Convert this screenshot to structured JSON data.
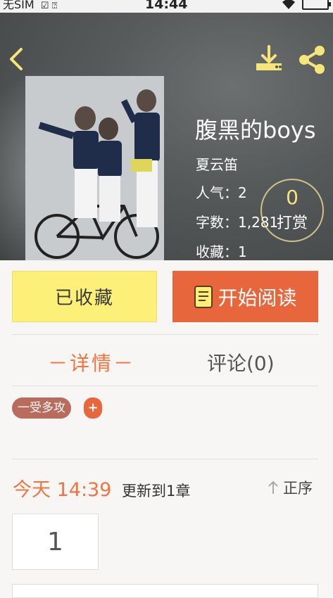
{
  "status_bar": {
    "carrier": "无SIM",
    "time": "14:44"
  },
  "book": {
    "title": "腹黑的boys",
    "author": "夏云笛",
    "popularity_label": "人气：",
    "popularity": "2",
    "words_label": "字数：",
    "words": "1,281",
    "favorites_label": "收藏：",
    "favorites": "1"
  },
  "reward": {
    "count": "0",
    "label": "打赏"
  },
  "actions": {
    "favorited_label": "已收藏",
    "read_label": "开始阅读"
  },
  "tabs": {
    "detail": "－详情－",
    "comments": "评论(0)"
  },
  "tags": [
    "一受多攻"
  ],
  "tag_add": "+",
  "update": {
    "when": "今天 14:39",
    "desc": "更新到1章",
    "sort_label": "正序"
  },
  "chapters": [
    "1"
  ],
  "colors": {
    "accent": "#e8663b",
    "fav_button": "#fdf078",
    "tag": "#b96c5b",
    "icon_yellow": "#f6e57a"
  },
  "icons": {
    "back": "chevron-left-icon",
    "download": "download-icon",
    "share": "share-icon",
    "book": "book-icon",
    "sort": "arrow-up-icon"
  }
}
